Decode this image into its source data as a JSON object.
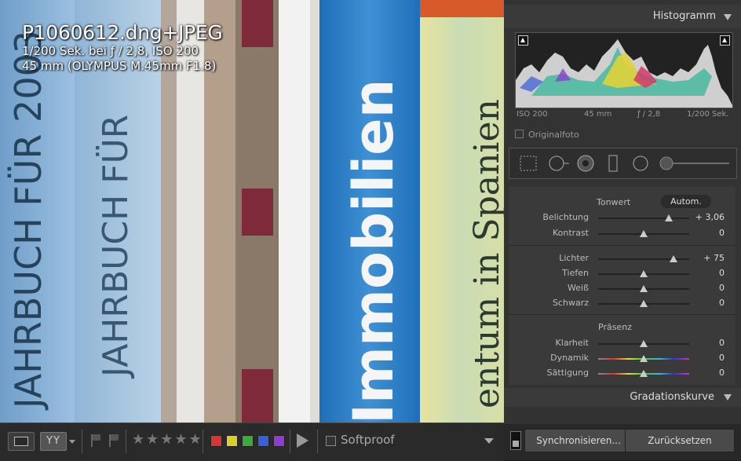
{
  "overlay": {
    "filename": "P1060612.dng+JPEG",
    "exposure_line": "1/200 Sek. bei ƒ / 2,8, ISO 200",
    "lens_line": "45 mm (OLYMPUS M.45mm F1.8)"
  },
  "photo": {
    "spine1_text": "JAHRBUCH FÜR 2003",
    "spine2_text": "JAHRBUCH FÜR",
    "spine3_text": "Immobilien",
    "spine4_text": "entum in Spanien"
  },
  "histogram": {
    "title": "Histogramm",
    "iso": "ISO 200",
    "focal": "45 mm",
    "aperture": "ƒ / 2,8",
    "shutter": "1/200 Sek.",
    "original_label": "Originalfoto"
  },
  "basic": {
    "tonwert_label": "Tonwert",
    "auto_label": "Autom.",
    "presence_label": "Präsenz",
    "sliders": [
      {
        "label": "Belichtung",
        "value": "+ 3,06",
        "level": 0.78
      },
      {
        "label": "Kontrast",
        "value": "0",
        "level": 0.5
      },
      {
        "label": "Lichter",
        "value": "+ 75",
        "level": 0.83
      },
      {
        "label": "Tiefen",
        "value": "0",
        "level": 0.5
      },
      {
        "label": "Weiß",
        "value": "0",
        "level": 0.5
      },
      {
        "label": "Schwarz",
        "value": "0",
        "level": 0.5
      },
      {
        "label": "Klarheit",
        "value": "0",
        "level": 0.5
      },
      {
        "label": "Dynamik",
        "value": "0",
        "level": 0.5
      },
      {
        "label": "Sättigung",
        "value": "0",
        "level": 0.5
      }
    ]
  },
  "curve": {
    "title": "Gradationskurve"
  },
  "toolbar": {
    "yy_label": "YY",
    "stars": "★★★★★",
    "softproof_label": "Softproof",
    "color_labels": [
      "#d9343a",
      "#d8cf2a",
      "#3daa3d",
      "#3c5fd9",
      "#8a3fd0"
    ]
  },
  "buttons": {
    "sync_label": "Synchronisieren...",
    "reset_label": "Zurücksetzen"
  }
}
